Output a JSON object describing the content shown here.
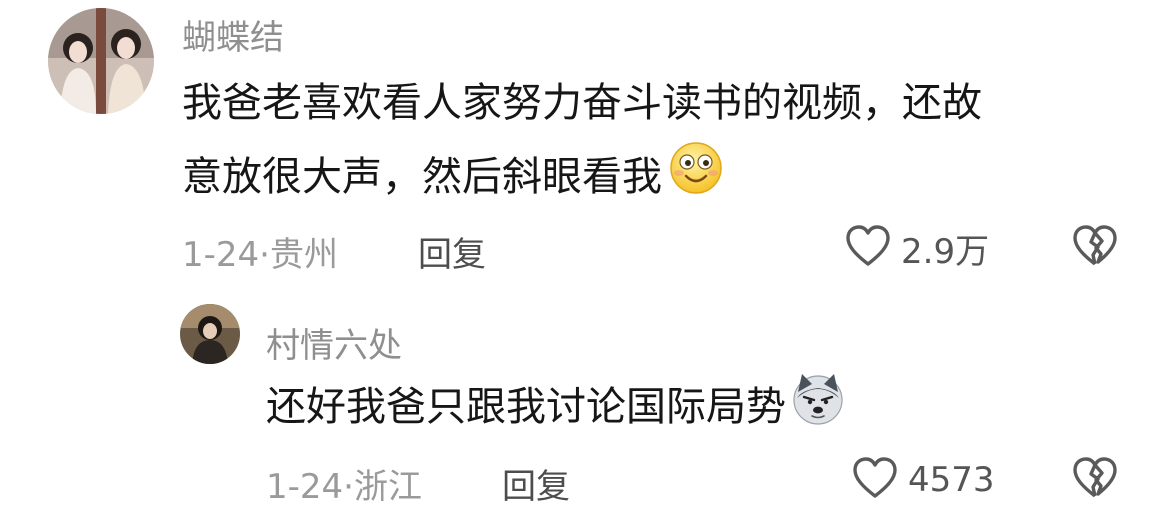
{
  "comments": [
    {
      "username": "蝴蝶结",
      "text_line1": "我爸老喜欢看人家努力奋斗读书的视频，还故",
      "text_line2": "意放很大声，然后斜眼看我",
      "emoji": "smile-emoji",
      "date": "1-24",
      "location": "贵州",
      "reply_label": "回复",
      "like_count": "2.9万"
    },
    {
      "username": "村情六处",
      "text": "还好我爸只跟我讨论国际局势",
      "emoji": "doge-emoji",
      "date": "1-24",
      "location": "浙江",
      "reply_label": "回复",
      "like_count": "4573"
    }
  ],
  "separator": "·",
  "colors": {
    "username": "#8f8f8f",
    "text": "#161616",
    "meta": "#9a9a9a",
    "icon_stroke": "#5a5a5a"
  }
}
